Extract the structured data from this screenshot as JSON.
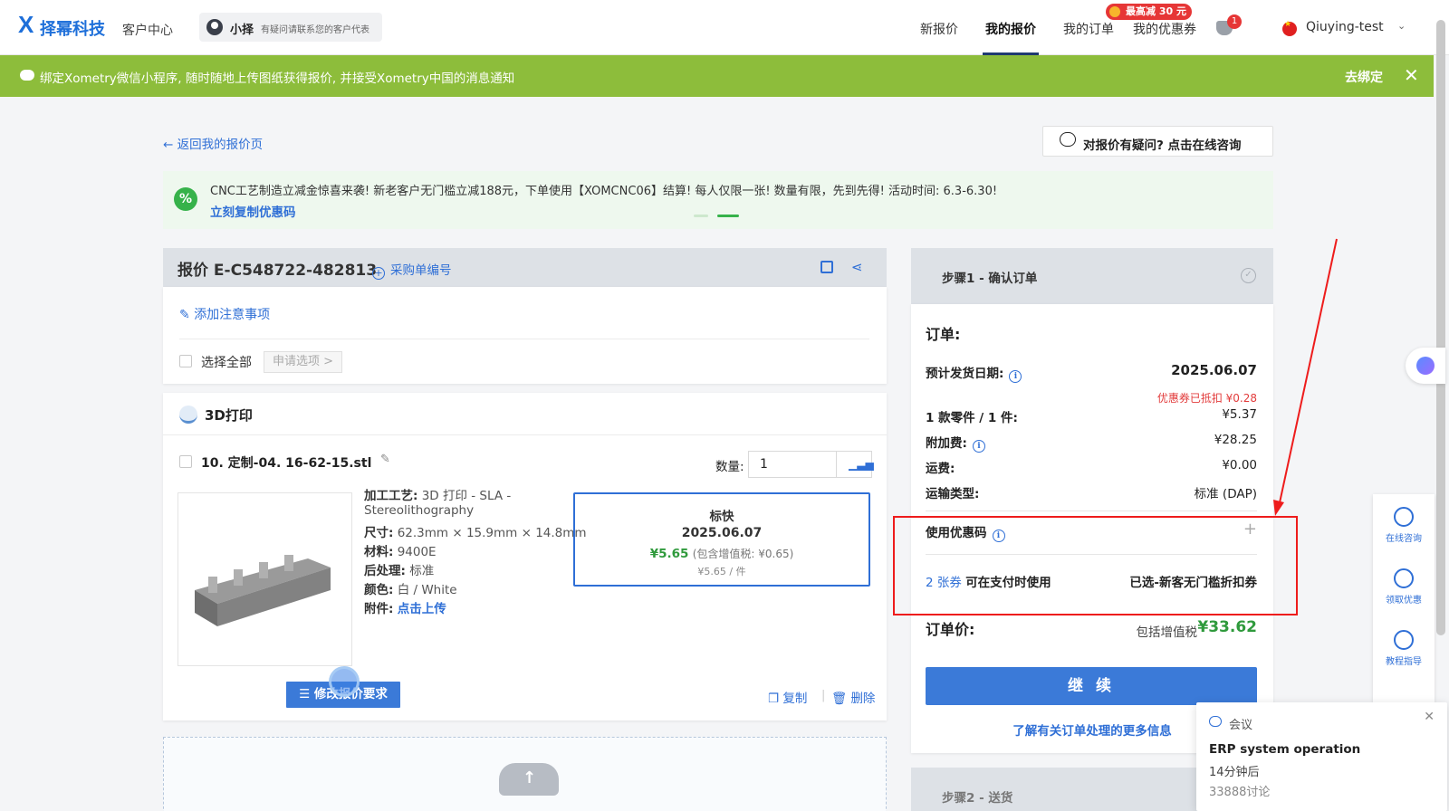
{
  "header": {
    "logo_text": "择幂科技",
    "customer_center": "客户中心",
    "rep_name": "小择",
    "rep_note": "有疑问请联系您的客户代表",
    "nav": [
      "新报价",
      "我的报价",
      "我的订单",
      "我的优惠券"
    ],
    "promo_badge": "最高减 30 元",
    "notification_count": "1",
    "user": "Qiuying-test"
  },
  "banner": {
    "text": "绑定Xometry微信小程序, 随时随地上传图纸获得报价, 并接受Xometry中国的消息通知",
    "bind": "去绑定",
    "close": "✕"
  },
  "back_link": "← 返回我的报价页",
  "consult": "对报价有疑问? 点击在线咨询",
  "notice": {
    "text": "CNC工艺制造立减金惊喜来袭! 新老客户无门槛立减188元，下单使用【XOMCNC06】结算! 每人仅限一张! 数量有限，先到先得! 活动时间: 6.3-6.30!",
    "link": "立刻复制优惠码",
    "icon_text": "%"
  },
  "quote": {
    "title": "报价 E-C548722-482813",
    "po_link": "采购单编号",
    "add_note": "添加注意事项",
    "select_all": "选择全部",
    "apply_option": "申请选项 >"
  },
  "part": {
    "section_title": "3D打印",
    "file_name": "10. 定制-04. 16-62-15.stl",
    "qty_label": "数量:",
    "qty_value": "1",
    "specs": [
      {
        "label": "加工工艺:",
        "value": "3D 打印 - SLA -"
      },
      {
        "label": "",
        "value": "Stereolithography"
      },
      {
        "label": "尺寸:",
        "value": "62.3mm × 15.9mm × 14.8mm"
      },
      {
        "label": "材料:",
        "value": "9400E"
      },
      {
        "label": "后处理:",
        "value": "标准"
      },
      {
        "label": "颜色:",
        "value": "白 / White"
      },
      {
        "label": "附件:",
        "value": "点击上传"
      }
    ],
    "option": {
      "label": "标快",
      "date": "2025.06.07",
      "price": "¥5.65",
      "vat_note": "(包含增值税: ¥0.65)",
      "unit_price": "¥5.65 / 件"
    },
    "modify_button": "修改报价要求",
    "copy": "复制",
    "delete": "删除"
  },
  "order": {
    "step1_title": "步骤1 - 确认订单",
    "order_label": "订单:",
    "ship_date_label": "预计发货日期:",
    "ship_date": "2025.06.07",
    "coupon_applied": "优惠券已抵扣 ¥0.28",
    "parts_label": "1 款零件 / 1 件:",
    "parts_value": "¥5.37",
    "surcharge_label": "附加费:",
    "surcharge_value": "¥28.25",
    "shipping_label": "运费:",
    "shipping_value": "¥0.00",
    "ship_type_label": "运输类型:",
    "ship_type_value": "标准 (DAP)",
    "coupon_label": "使用优惠码",
    "coupon_count": "2 张券",
    "coupon_count_suffix": "可在支付时使用",
    "coupon_selected": "已选-新客无门槛折扣券",
    "total_label": "订单价:",
    "total_note": "包括增值税",
    "total_value": "¥33.62",
    "continue": "继 续",
    "learn_more": "了解有关订单处理的更多信息",
    "step2_title": "步骤2 - 送货"
  },
  "side_tools": [
    "在线咨询",
    "领取优惠",
    "教程指导"
  ],
  "toast": {
    "type": "会议",
    "title": "ERP system operation",
    "time": "14分钟后",
    "count": "33888讨论"
  },
  "colors": {
    "brand": "#1e6fd9",
    "banner_green": "#8dbd3b",
    "price_green": "#2f9a3c",
    "annotation_red": "#ee1c1c"
  }
}
